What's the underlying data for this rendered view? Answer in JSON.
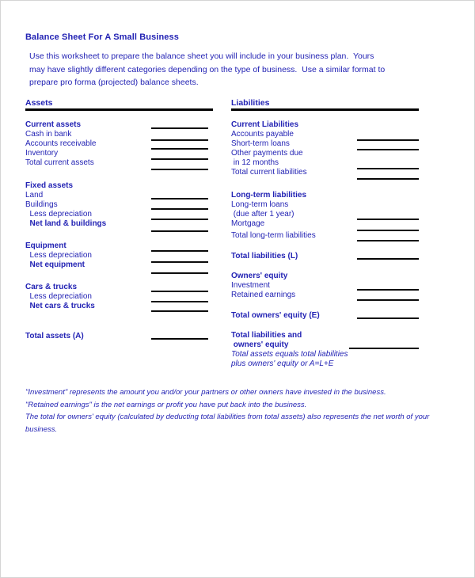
{
  "document": {
    "title": "Balance Sheet For A Small Business",
    "intro_lines": [
      "Use this worksheet to prepare the balance sheet you will include in your business plan.  Yours",
      "may have slightly different categories depending on the type of business.  Use a similar format to",
      "prepare pro forma (projected) balance sheets."
    ],
    "ink_color": "#2323b4",
    "rule_color": "#111111"
  },
  "assets": {
    "heading": "Assets",
    "rows": [
      {
        "label": "Current assets",
        "bold": true,
        "indent": 0
      },
      {
        "label": "Cash in bank",
        "bold": false,
        "indent": 0
      },
      {
        "label": "Accounts receivable",
        "bold": false,
        "indent": 0
      },
      {
        "label": "Inventory",
        "bold": false,
        "indent": 0
      },
      {
        "label": "Total current assets",
        "bold": false,
        "indent": 0
      },
      {
        "label": "Fixed assets",
        "bold": true,
        "indent": 0
      },
      {
        "label": "Land",
        "bold": false,
        "indent": 0
      },
      {
        "label": "Buildings",
        "bold": false,
        "indent": 0
      },
      {
        "label": "  Less depreciation",
        "bold": false,
        "indent": 1
      },
      {
        "label": "  Net land & buildings",
        "bold": true,
        "indent": 1
      },
      {
        "label": "Equipment",
        "bold": false,
        "indent": 0
      },
      {
        "label": "  Less depreciation",
        "bold": false,
        "indent": 1
      },
      {
        "label": "  Net equipment",
        "bold": true,
        "indent": 1
      },
      {
        "label": "Cars & trucks",
        "bold": true,
        "indent": 0
      },
      {
        "label": "  Less depreciation",
        "bold": false,
        "indent": 1
      },
      {
        "label": "  Net cars & trucks",
        "bold": true,
        "indent": 1
      },
      {
        "label": "Total assets (A)",
        "bold": true,
        "indent": 0
      }
    ]
  },
  "liabilities": {
    "heading": "Liabilities",
    "rows": [
      {
        "label": "Current Liabilities",
        "bold": true,
        "indent": 0
      },
      {
        "label": "Accounts payable",
        "bold": false,
        "indent": 0
      },
      {
        "label": "Short-term loans",
        "bold": false,
        "indent": 0
      },
      {
        "label": "Other payments due",
        "bold": false,
        "indent": 0
      },
      {
        "label": " in 12 months",
        "bold": false,
        "indent": 1
      },
      {
        "label": "Total current liabilities",
        "bold": false,
        "indent": 0
      },
      {
        "label": "Long-term liabilities",
        "bold": true,
        "indent": 0
      },
      {
        "label": "Long-term loans",
        "bold": false,
        "indent": 0
      },
      {
        "label": " (due after 1 year)",
        "bold": false,
        "indent": 1
      },
      {
        "label": "Mortgage",
        "bold": false,
        "indent": 0
      },
      {
        "label": "Total long-term liabilities",
        "bold": false,
        "indent": 0
      },
      {
        "label": "Total liabilities (L)",
        "bold": true,
        "indent": 0
      },
      {
        "label": "Owners' equity",
        "bold": true,
        "indent": 0
      },
      {
        "label": "Investment",
        "bold": false,
        "indent": 0
      },
      {
        "label": "Retained earnings",
        "bold": false,
        "indent": 0
      },
      {
        "label": "Total owners' equity (E)",
        "bold": true,
        "indent": 0
      },
      {
        "label": "Total liabilities and",
        "bold": true,
        "indent": 0
      },
      {
        "label": " owners' equity",
        "bold": true,
        "indent": 1
      },
      {
        "label": "Total assets equals total liabilities",
        "bold": false,
        "indent": 0,
        "italic": true
      },
      {
        "label": "plus owners' equity or A=L+E",
        "bold": false,
        "indent": 0,
        "italic": true
      }
    ]
  },
  "footnotes": [
    "\"Investment\" represents the amount you and/or your partners or other owners have invested in the business.",
    "\"Retained earnings\" is the net earnings or profit you have put back into the business.",
    "The total for owners' equity (calculated by deducting total liabilities from total assets) also represents the net worth of your business."
  ]
}
